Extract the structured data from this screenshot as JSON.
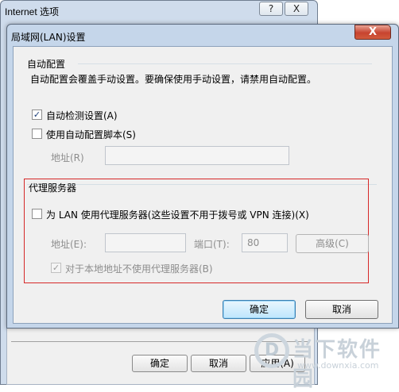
{
  "background_window": {
    "title": "Internet 选项",
    "help_button": "?",
    "close_button": "X",
    "buttons": {
      "ok": "确定",
      "cancel": "取消",
      "apply": "应用(A)"
    }
  },
  "dialog": {
    "title": "局域网(LAN)设置",
    "close_button": "X",
    "auto_config": {
      "group_title": "自动配置",
      "description": "自动配置会覆盖手动设置。要确保使用手动设置，请禁用自动配置。",
      "auto_detect": {
        "label": "自动检测设置(A)",
        "checked": true
      },
      "use_script": {
        "label": "使用自动配置脚本(S)",
        "checked": false
      },
      "address_label": "地址(R)",
      "address_value": ""
    },
    "proxy": {
      "group_title": "代理服务器",
      "use_proxy": {
        "label": "为 LAN 使用代理服务器(这些设置不用于拨号或 VPN 连接)(X)",
        "checked": false
      },
      "address_label": "地址(E):",
      "address_value": "",
      "port_label": "端口(T):",
      "port_value": "80",
      "advanced_button": "高级(C)",
      "bypass_local": {
        "label": "对于本地地址不使用代理服务器(B)",
        "checked": true
      }
    },
    "ok_button": "确定",
    "cancel_button": "取消"
  },
  "watermark": {
    "logo": "D",
    "text": "当下软件园",
    "url": "www.downxia.com"
  },
  "colors": {
    "highlight_box": "#d62828",
    "dialog_frame": "#c5d6ea",
    "close_button": "#c7432f"
  }
}
